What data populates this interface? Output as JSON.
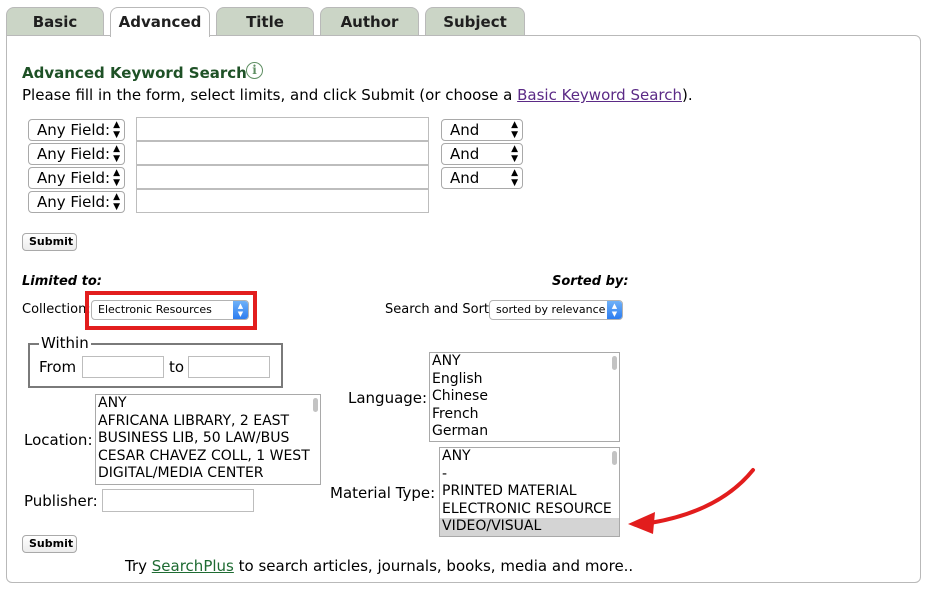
{
  "tabs": [
    {
      "label": "Basic"
    },
    {
      "label": "Advanced"
    },
    {
      "label": "Title"
    },
    {
      "label": "Author"
    },
    {
      "label": "Subject"
    }
  ],
  "heading": "Advanced Keyword Search",
  "intro": {
    "prefix": "Please fill in the form, select limits, and click Submit (or choose a ",
    "link": "Basic Keyword Search",
    "suffix": ")."
  },
  "search_rows": [
    {
      "field": "Any Field:",
      "value": "",
      "operator": "And"
    },
    {
      "field": "Any Field:",
      "value": "",
      "operator": "And"
    },
    {
      "field": "Any Field:",
      "value": "",
      "operator": "And"
    },
    {
      "field": "Any Field:",
      "value": ""
    }
  ],
  "submit_label": "Submit",
  "limited_to_label": "Limited to:",
  "sorted_by_label": "Sorted by:",
  "collection": {
    "label": "Collection:",
    "value": "Electronic Resources"
  },
  "search_sort": {
    "label": "Search and Sort:",
    "value": "sorted by relevance"
  },
  "within": {
    "legend": "Within",
    "from_label": "From",
    "to_label": "to",
    "from_value": "",
    "to_value": ""
  },
  "location": {
    "label": "Location:",
    "options": [
      "ANY",
      "AFRICANA LIBRARY, 2 EAST",
      "BUSINESS LIB, 50 LAW/BUS",
      "CESAR CHAVEZ COLL, 1 WEST",
      "DIGITAL/MEDIA CENTER"
    ]
  },
  "publisher": {
    "label": "Publisher:",
    "value": ""
  },
  "language": {
    "label": "Language:",
    "options": [
      "ANY",
      "English",
      "Chinese",
      "French",
      "German"
    ]
  },
  "material_type": {
    "label": "Material Type:",
    "options": [
      "ANY",
      "-",
      "PRINTED MATERIAL",
      "ELECTRONIC RESOURCE",
      "VIDEO/VISUAL"
    ],
    "selected": "VIDEO/VISUAL"
  },
  "footer": {
    "prefix": "Try ",
    "link": "SearchPlus",
    "suffix": " to search articles, journals, books, media and more.."
  },
  "colors": {
    "tab_bg": "#cbd5c6",
    "heading": "#1e5126",
    "link_visited": "#5b2a86",
    "annotation_red": "#e21d1d"
  },
  "icons": [
    "info-icon",
    "select-arrows-icon",
    "annotation-arrow-icon"
  ]
}
